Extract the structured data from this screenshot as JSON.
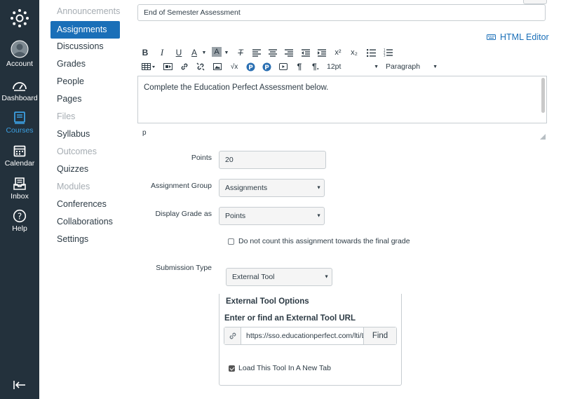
{
  "global_nav": {
    "account": "Account",
    "dashboard": "Dashboard",
    "courses": "Courses",
    "calendar": "Calendar",
    "inbox": "Inbox",
    "help": "Help"
  },
  "course_nav": {
    "items": [
      {
        "label": "Announcements",
        "state": "disabled"
      },
      {
        "label": "Assignments",
        "state": "active"
      },
      {
        "label": "Discussions",
        "state": "normal"
      },
      {
        "label": "Grades",
        "state": "normal"
      },
      {
        "label": "People",
        "state": "normal"
      },
      {
        "label": "Pages",
        "state": "normal"
      },
      {
        "label": "Files",
        "state": "disabled"
      },
      {
        "label": "Syllabus",
        "state": "normal"
      },
      {
        "label": "Outcomes",
        "state": "disabled"
      },
      {
        "label": "Quizzes",
        "state": "normal"
      },
      {
        "label": "Modules",
        "state": "disabled"
      },
      {
        "label": "Conferences",
        "state": "normal"
      },
      {
        "label": "Collaborations",
        "state": "normal"
      },
      {
        "label": "Settings",
        "state": "normal"
      }
    ]
  },
  "form": {
    "title_value": "End of Semester Assessment",
    "html_editor_label": "HTML Editor",
    "toolbar": {
      "bold": "B",
      "italic": "I",
      "underline": "U",
      "font_color": "A",
      "bg_color": "A",
      "clear_format": "T",
      "superscript": "x²",
      "subscript": "x₂",
      "font_size": "12pt",
      "format": "Paragraph"
    },
    "editor_content": "Complete the Education Perfect Assessment below.",
    "editor_path": "p",
    "points_label": "Points",
    "points_value": "20",
    "group_label": "Assignment Group",
    "group_value": "Assignments",
    "display_label": "Display Grade as",
    "display_value": "Points",
    "no_count_label": "Do not count this assignment towards the final grade",
    "submission_label": "Submission Type",
    "submission_value": "External Tool",
    "tool_options_title": "External Tool Options",
    "tool_url_title": "Enter or find an External Tool URL",
    "tool_url_value": "https://sso.educationperfect.com/lti/La",
    "find_label": "Find",
    "new_tab_label": "Load This Tool In A New Tab"
  }
}
